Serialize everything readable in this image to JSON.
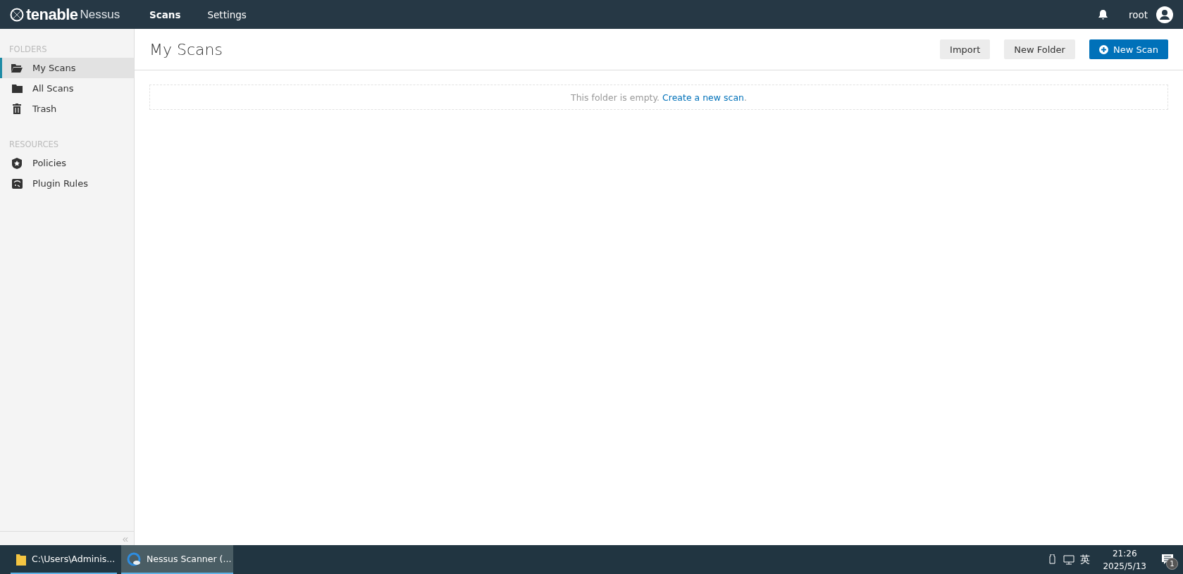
{
  "topbar": {
    "brand": "tenable",
    "product": "Nessus",
    "nav": [
      {
        "label": "Scans",
        "selected": true
      },
      {
        "label": "Settings",
        "selected": false
      }
    ],
    "user": "root"
  },
  "sidebar": {
    "sections": [
      {
        "heading": "FOLDERS",
        "items": [
          {
            "label": "My Scans",
            "kind": "folder-open",
            "selected": true
          },
          {
            "label": "All Scans",
            "kind": "folder",
            "selected": false
          },
          {
            "label": "Trash",
            "kind": "trash",
            "selected": false
          }
        ]
      },
      {
        "heading": "RESOURCES",
        "items": [
          {
            "label": "Policies",
            "kind": "shield",
            "selected": false
          },
          {
            "label": "Plugin Rules",
            "kind": "rules",
            "selected": false
          }
        ]
      }
    ],
    "collapse": "«"
  },
  "main": {
    "title": "My Scans",
    "buttons": [
      {
        "label": "Import",
        "kind": "plain"
      },
      {
        "label": "New Folder",
        "kind": "plain"
      },
      {
        "label": "New Scan",
        "kind": "primary"
      }
    ],
    "empty_text": "This folder is empty.",
    "empty_link": "Create a new scan",
    "empty_end": "."
  },
  "taskbar": {
    "items": [
      {
        "label": "C:\\Users\\Adminis...",
        "kind": "folder",
        "selected": false
      },
      {
        "label": "Nessus Scanner (...",
        "kind": "browser",
        "selected": true
      }
    ],
    "ime": "英",
    "time": "21:26",
    "date": "2025/5/13",
    "notifications": "1"
  }
}
